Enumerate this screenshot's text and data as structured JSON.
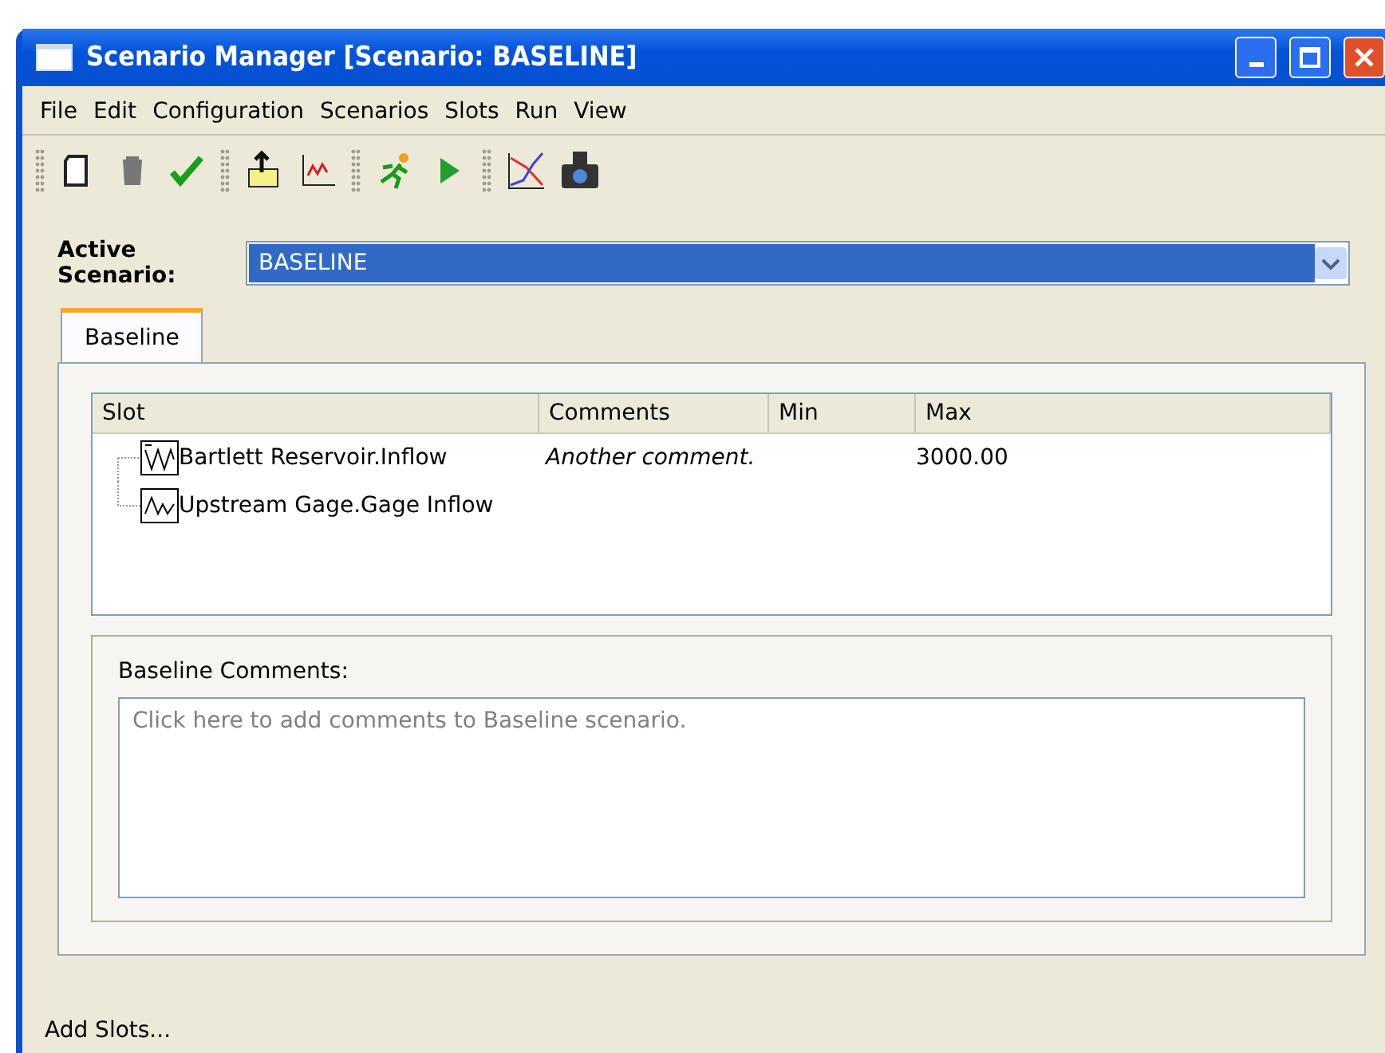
{
  "window": {
    "title": "Scenario Manager [Scenario: BASELINE]"
  },
  "menu": [
    "File",
    "Edit",
    "Configuration",
    "Scenarios",
    "Slots",
    "Run",
    "View"
  ],
  "active_scenario": {
    "label": "Active Scenario:",
    "value": "BASELINE"
  },
  "tabs": [
    {
      "label": "Baseline",
      "selected": true
    }
  ],
  "table": {
    "columns": [
      "Slot",
      "Comments",
      "Min",
      "Max"
    ],
    "rows": [
      {
        "slot": "Bartlett Reservoir.Inflow",
        "comments": "Another comment.",
        "max": "3000.00",
        "kind": "multi"
      },
      {
        "slot": "Upstream Gage.Gage Inflow",
        "kind": "single"
      }
    ]
  },
  "comments": {
    "label": "Baseline Comments:",
    "placeholder": "Click here to add comments to Baseline scenario."
  },
  "status_bar": "Add Slots..."
}
